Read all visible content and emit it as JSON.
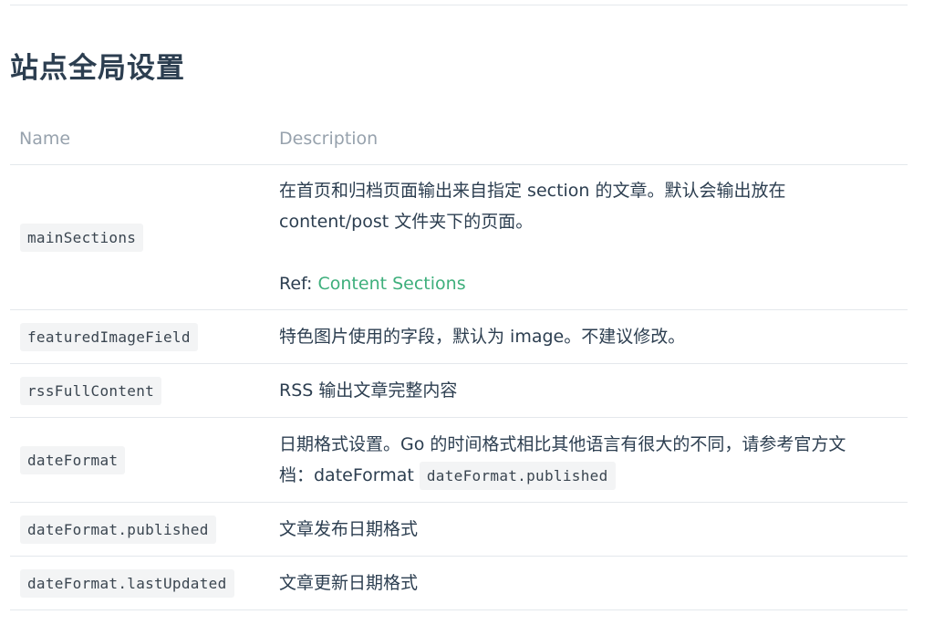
{
  "page": {
    "section_title": "站点全局设置"
  },
  "table": {
    "headers": {
      "name": "Name",
      "description": "Description"
    },
    "rows": [
      {
        "name": "mainSections",
        "desc_line1": "在首页和归档页面输出来自指定 section 的文章。默认会输出放在",
        "desc_line2": "content/post 文件夹下的页面。",
        "ref_prefix": "Ref: ",
        "ref_link": "Content Sections"
      },
      {
        "name": "featuredImageField",
        "desc": "特色图片使用的字段，默认为 image。不建议修改。"
      },
      {
        "name": "rssFullContent",
        "desc": "RSS 输出文章完整内容"
      },
      {
        "name": "dateFormat",
        "desc_line1": "日期格式设置。Go 的时间格式相比其他语言有很大的不同，请参考官方文",
        "desc_line2_prefix": "档：dateFormat",
        "desc_line2_code": "dateFormat.published"
      },
      {
        "name": "dateFormat.published",
        "desc": "文章发布日期格式"
      },
      {
        "name": "dateFormat.lastUpdated",
        "desc": "文章更新日期格式"
      }
    ]
  }
}
